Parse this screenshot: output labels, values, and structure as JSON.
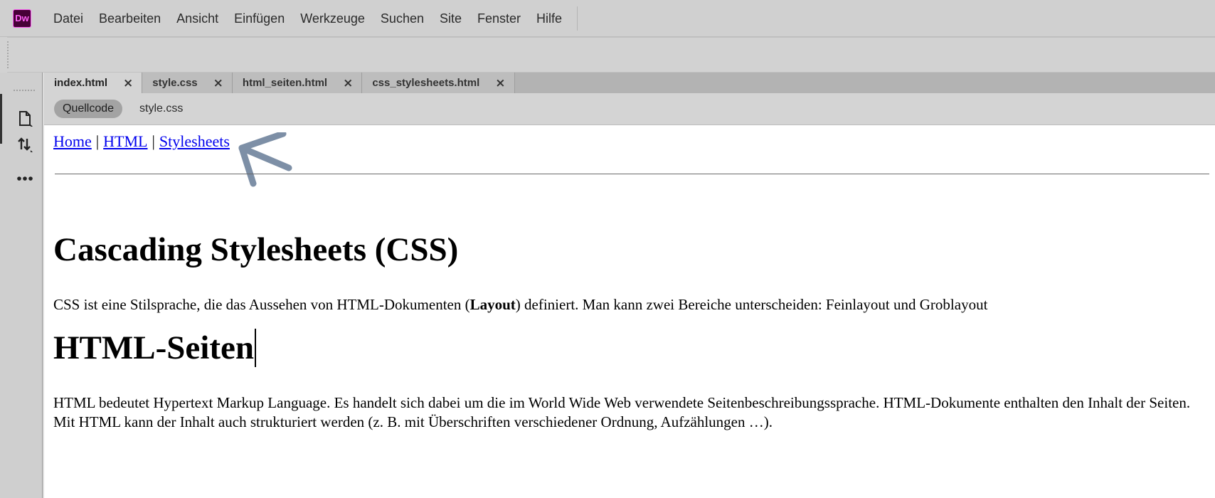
{
  "app": {
    "logo_text": "Dw",
    "logo_color": "#ff61f6"
  },
  "menu": {
    "items": [
      "Datei",
      "Bearbeiten",
      "Ansicht",
      "Einfügen",
      "Werkzeuge",
      "Suchen",
      "Site",
      "Fenster",
      "Hilfe"
    ]
  },
  "tabs": [
    {
      "label": "index.html",
      "active": true
    },
    {
      "label": "style.css",
      "active": false
    },
    {
      "label": "html_seiten.html",
      "active": false
    },
    {
      "label": "css_stylesheets.html",
      "active": false
    }
  ],
  "tab_close_glyph": "×",
  "related_files": {
    "source_label": "Quellcode",
    "file": "style.css"
  },
  "left_rail_icons": [
    "file-icon",
    "sort-arrows-icon",
    "more-icon"
  ],
  "page": {
    "nav": {
      "links": [
        "Home",
        "HTML",
        "Stylesheets"
      ],
      "separator": "|"
    },
    "heading1": "Cascading Stylesheets (CSS)",
    "para1_before": "CSS ist eine Stilsprache, die das Aussehen von HTML-Dokumenten (",
    "para1_bold": "Layout",
    "para1_after": ") definiert. Man kann zwei Bereiche unterscheiden: Feinlayout und Groblayout",
    "heading2": "HTML-Seiten",
    "para2": "HTML bedeutet Hypertext Markup Language. Es handelt sich dabei um die im World Wide Web verwendete Seitenbeschreibungssprache. HTML-Dokumente enthalten den Inhalt der Seiten. Mit HTML kann der Inhalt auch strukturiert werden (z. B. mit Überschriften verschiedener Ordnung, Aufzählungen …)."
  },
  "annotation_color": "#7d8fa6"
}
